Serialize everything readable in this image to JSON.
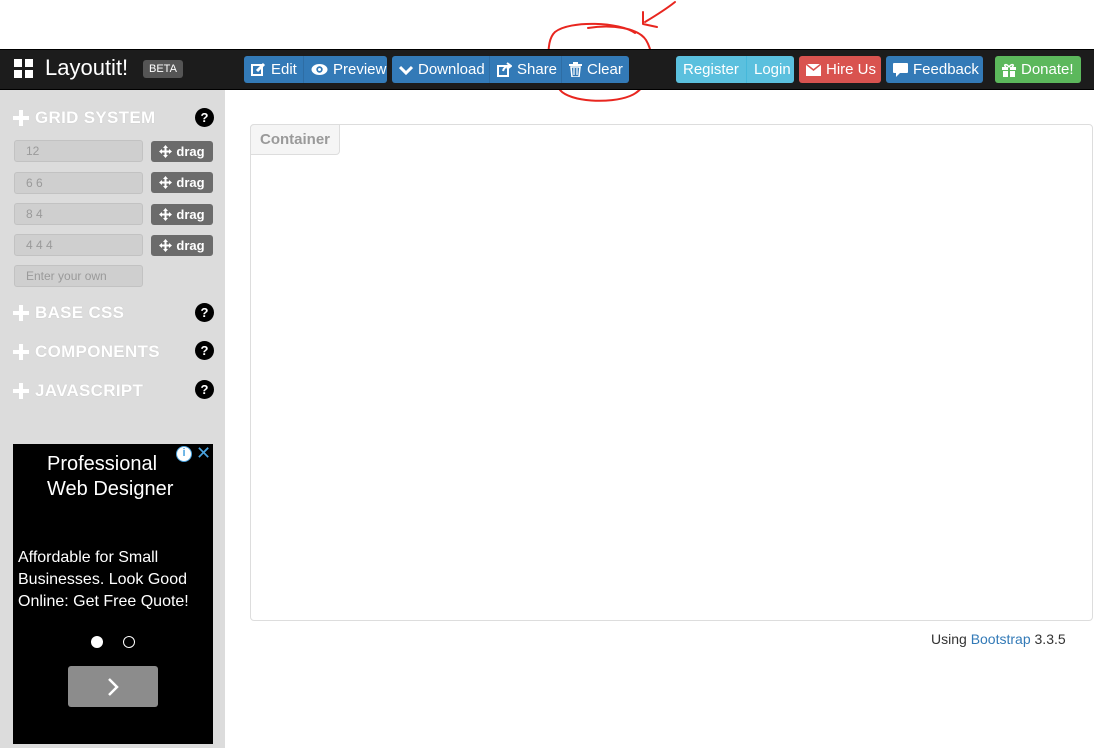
{
  "app": {
    "title": "Layoutit!",
    "badge": "BETA"
  },
  "toolbar": {
    "edit": "Edit",
    "preview": "Preview",
    "download": "Download",
    "share": "Share",
    "clear": "Clear",
    "register": "Register",
    "login": "Login",
    "hire": "Hire Us",
    "feedback": "Feedback",
    "donate": "Donate!"
  },
  "sidebar": {
    "sections": [
      {
        "label": "GRID SYSTEM"
      },
      {
        "label": "BASE CSS"
      },
      {
        "label": "COMPONENTS"
      },
      {
        "label": "JAVASCRIPT"
      }
    ],
    "help": "?",
    "grid_rows": [
      {
        "value": "12",
        "drag": "drag"
      },
      {
        "value": "6 6",
        "drag": "drag"
      },
      {
        "value": "8 4",
        "drag": "drag"
      },
      {
        "value": "4 4 4",
        "drag": "drag"
      }
    ],
    "custom_placeholder": "Enter your own"
  },
  "ad": {
    "title": "Professional Web Designer",
    "body": "Affordable for Small Businesses. Look Good Online: Get Free Quote!",
    "info": "i",
    "close": "✕"
  },
  "main": {
    "container_label": "Container",
    "footer_prefix": "Using",
    "footer_link": "Bootstrap",
    "footer_version": "3.3.5"
  },
  "colors": {
    "navbar": "#1c1c1c",
    "primary": "#337ab7",
    "info": "#5bc0de",
    "danger": "#d9534f",
    "success": "#5cb85c",
    "annotation": "#e8261f"
  }
}
